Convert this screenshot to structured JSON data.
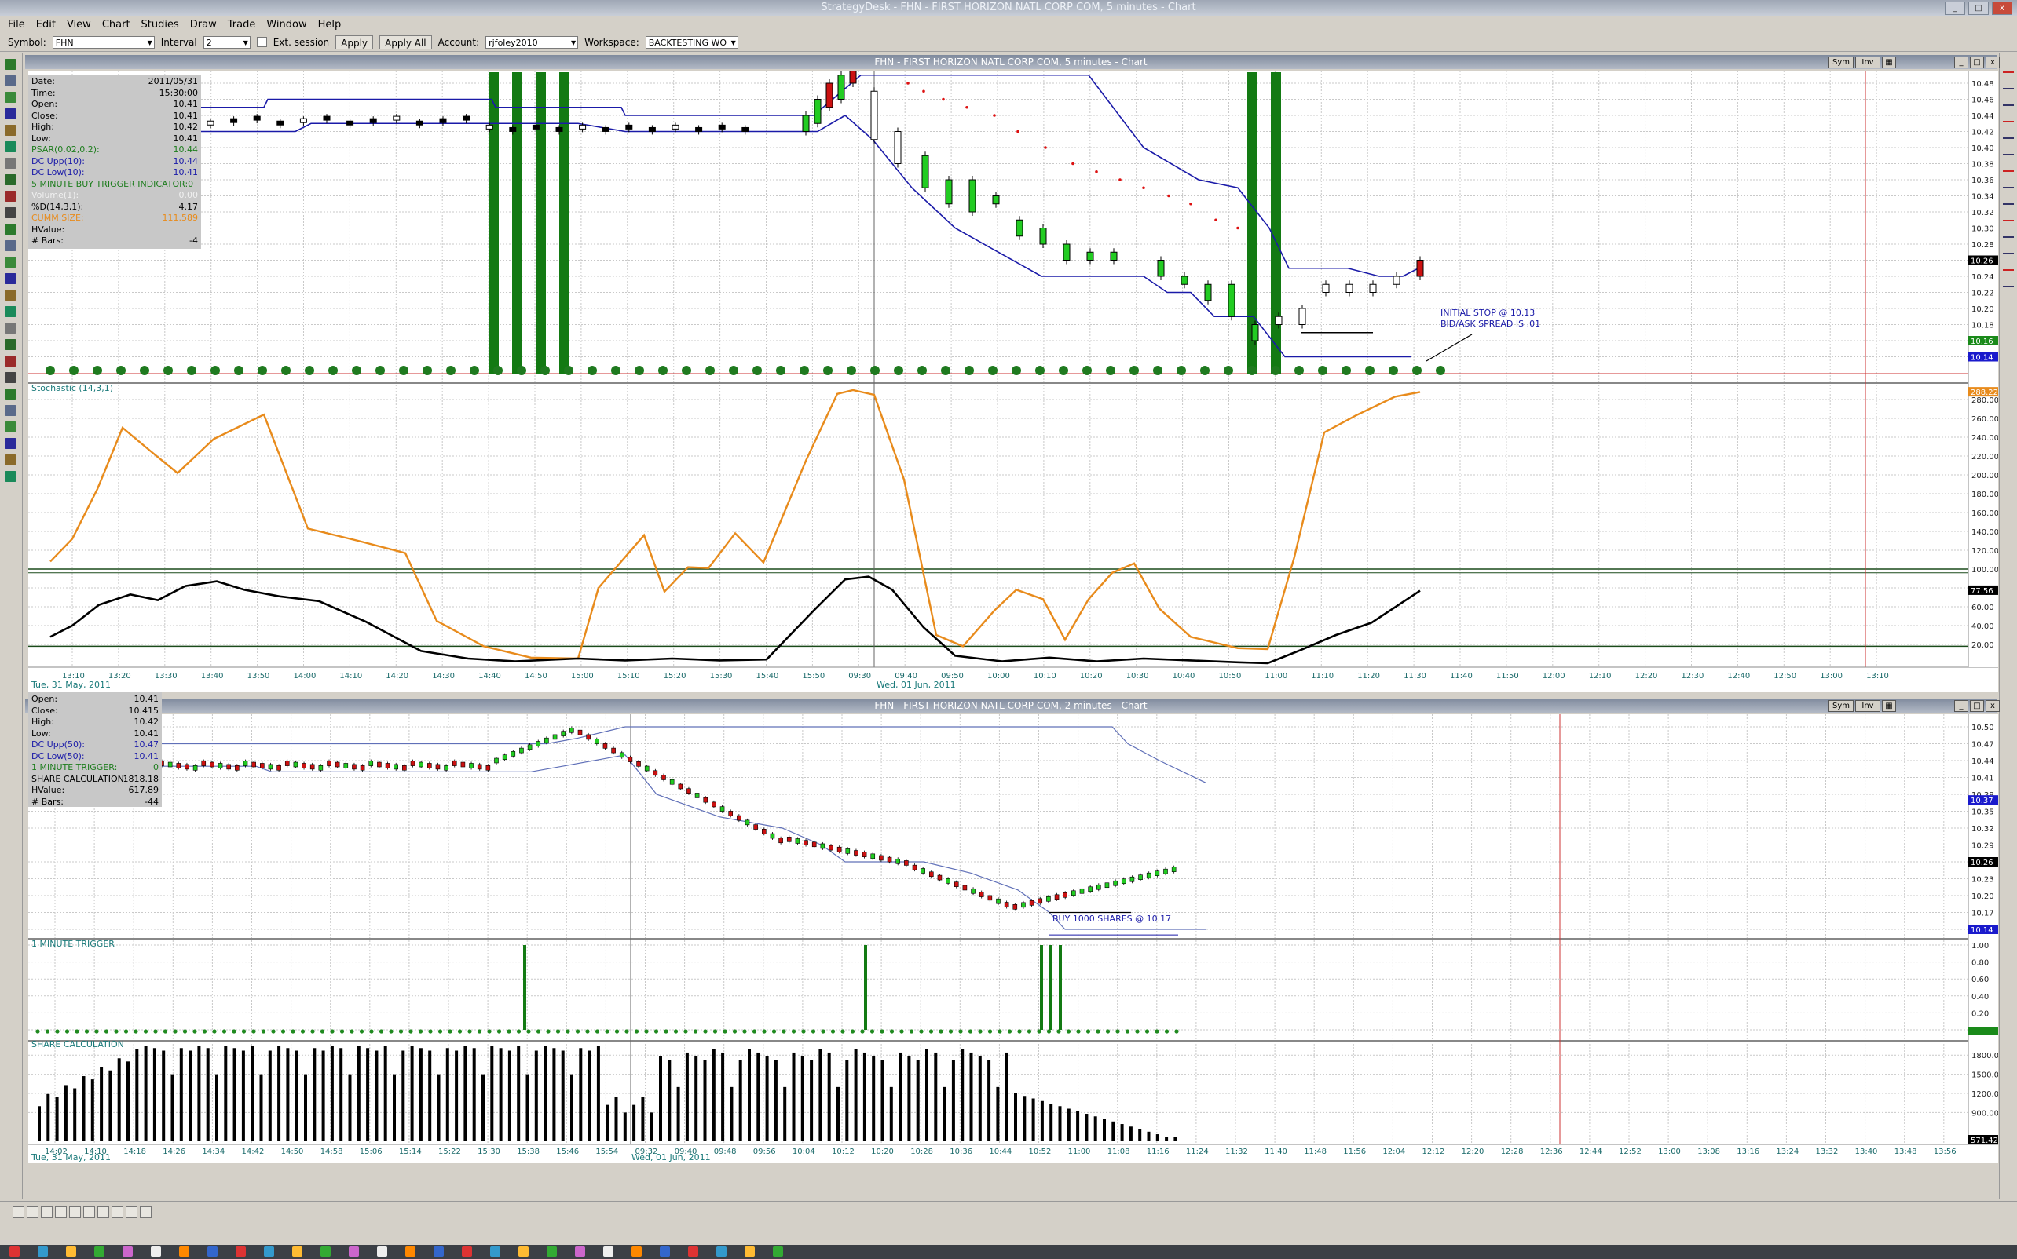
{
  "window": {
    "title": "StrategyDesk - FHN - FIRST HORIZON NATL CORP COM, 5 minutes - Chart",
    "controls": [
      "_",
      "□",
      "x"
    ]
  },
  "menu": [
    "File",
    "Edit",
    "View",
    "Chart",
    "Studies",
    "Draw",
    "Trade",
    "Window",
    "Help"
  ],
  "toolbar": {
    "symbol_label": "Symbol:",
    "symbol_value": "FHN",
    "interval_label": "Interval",
    "interval_value": "2",
    "ext_session_label": "Ext. session",
    "apply_label": "Apply",
    "apply_all_label": "Apply All",
    "account_label": "Account:",
    "account_value": "rjfoley2010",
    "workspace_label": "Workspace:",
    "workspace_value": "BACKTESTING WO"
  },
  "chart1": {
    "title": "FHN - FIRST HORIZON NATL CORP COM, 5 minutes - Chart",
    "hdr_buttons": [
      "Sym",
      "Inv"
    ],
    "info": [
      [
        "Date:",
        "2011/05/31",
        "#000"
      ],
      [
        "Time:",
        "15:30:00",
        "#000"
      ],
      [
        "Open:",
        "10.41",
        "#000"
      ],
      [
        "Close:",
        "10.41",
        "#000"
      ],
      [
        "High:",
        "10.42",
        "#000"
      ],
      [
        "Low:",
        "10.41",
        "#000"
      ],
      [
        "PSAR(0.02,0.2):",
        "10.44",
        "#1e7d1e"
      ],
      [
        "DC Upp(10):",
        "10.44",
        "#1a1aa8"
      ],
      [
        "DC Low(10):",
        "10.41",
        "#1a1aa8"
      ],
      [
        "5 MINUTE BUY TRIGGER INDICATOR:0",
        "",
        "#1e7d1e"
      ],
      [
        "Volume(1):",
        "0.00",
        "#f0f0f0"
      ],
      [
        "%D(14,3,1):",
        "4.17",
        "#000"
      ],
      [
        "CUMM.SIZE:",
        "111.589",
        "#e88b1c"
      ],
      [
        "HValue:",
        "",
        "#000"
      ],
      [
        "# Bars:",
        "-4",
        "#000"
      ]
    ],
    "price_axis": [
      "10.48",
      "10.46",
      "10.44",
      "10.42",
      "10.40",
      "10.38",
      "10.36",
      "10.34",
      "10.32",
      "10.30",
      "10.28",
      "10.26",
      "10.24",
      "10.22",
      "10.20",
      "10.18",
      "10.16",
      "10.14"
    ],
    "price_markers": [
      {
        "text": "10.26",
        "bg": "#000000"
      },
      {
        "text": "10.16",
        "bg": "#1a8a1a"
      },
      {
        "text": "10.14",
        "bg": "#1a1acc"
      }
    ],
    "annotations": [
      "INITIAL STOP @ 10.13",
      "BID/ASK SPREAD IS .01"
    ],
    "stoch_label": "Stochastic (14,3,1)",
    "stoch_axis": [
      "280.00",
      "260.00",
      "240.00",
      "220.00",
      "200.00",
      "180.00",
      "160.00",
      "140.00",
      "120.00",
      "100.00",
      "80.00",
      "60.00",
      "40.00",
      "20.00"
    ],
    "stoch_markers": [
      {
        "text": "288.225",
        "bg": "#e88b1c"
      },
      {
        "text": "77.56",
        "bg": "#000000"
      }
    ],
    "time_axis": [
      "13:10",
      "13:20",
      "13:30",
      "13:40",
      "13:50",
      "14:00",
      "14:10",
      "14:20",
      "14:30",
      "14:40",
      "14:50",
      "15:00",
      "15:10",
      "15:20",
      "15:30",
      "15:40",
      "15:50",
      "09:30",
      "09:40",
      "09:50",
      "10:00",
      "10:10",
      "10:20",
      "10:30",
      "10:40",
      "10:50",
      "11:00",
      "11:10",
      "11:20",
      "11:30",
      "11:40",
      "11:50",
      "12:00",
      "12:10",
      "12:20",
      "12:30",
      "12:40",
      "12:50",
      "13:00",
      "13:10"
    ],
    "date_left": "Tue, 31 May, 2011",
    "date_right": "Wed, 01 Jun, 2011"
  },
  "chart2": {
    "title": "FHN - FIRST HORIZON NATL CORP COM, 2 minutes - Chart",
    "hdr_buttons": [
      "Sym",
      "Inv"
    ],
    "info": [
      [
        "Open:",
        "10.41",
        "#000"
      ],
      [
        "Close:",
        "10.415",
        "#000"
      ],
      [
        "High:",
        "10.42",
        "#000"
      ],
      [
        "Low:",
        "10.41",
        "#000"
      ],
      [
        "DC Upp(50):",
        "10.47",
        "#1a1aa8"
      ],
      [
        "DC Low(50):",
        "10.41",
        "#1a1aa8"
      ],
      [
        "1 MINUTE TRIGGER:",
        "0",
        "#1e7d1e"
      ],
      [
        "SHARE CALCULATION:",
        "1818.18",
        "#000"
      ],
      [
        "HValue:",
        "617.89",
        "#000"
      ],
      [
        "# Bars:",
        "-44",
        "#000"
      ]
    ],
    "price_axis": [
      "10.50",
      "10.47",
      "10.44",
      "10.41",
      "10.38",
      "10.35",
      "10.32",
      "10.29",
      "10.26",
      "10.23",
      "10.20",
      "10.17",
      "10.14"
    ],
    "price_markers": [
      {
        "text": "10.37",
        "bg": "#1a1acc"
      },
      {
        "text": "10.26",
        "bg": "#000000"
      },
      {
        "text": "10.14",
        "bg": "#1a1acc"
      }
    ],
    "annotation": "BUY 1000 SHARES @ 10.17",
    "trigger_label": "1 MINUTE TRIGGER",
    "trigger_axis": [
      "1.00",
      "0.80",
      "0.60",
      "0.40",
      "0.20",
      "0"
    ],
    "share_label": "SHARE CALCULATION",
    "share_axis": [
      "1800.00",
      "1500.00",
      "1200.00",
      "900.00"
    ],
    "share_marker": "571.429",
    "time_axis": [
      "14:02",
      "14:10",
      "14:18",
      "14:26",
      "14:34",
      "14:42",
      "14:50",
      "14:58",
      "15:06",
      "15:14",
      "15:22",
      "15:30",
      "15:38",
      "15:46",
      "15:54",
      "09:32",
      "09:40",
      "09:48",
      "09:56",
      "10:04",
      "10:12",
      "10:20",
      "10:28",
      "10:36",
      "10:44",
      "10:52",
      "11:00",
      "11:08",
      "11:16",
      "11:24",
      "11:32",
      "11:40",
      "11:48",
      "11:56",
      "12:04",
      "12:12",
      "12:20",
      "12:28",
      "12:36",
      "12:44",
      "12:52",
      "13:00",
      "13:08",
      "13:16",
      "13:24",
      "13:32",
      "13:40",
      "13:48",
      "13:56"
    ],
    "date_left": "Tue, 31 May, 2011",
    "date_right": "Wed, 01 Jun, 2011"
  },
  "colors": {
    "grid": "#c9c9c9",
    "dc_line": "#1a1aa8",
    "stoch_orange": "#e88b1c",
    "stoch_black": "#000000",
    "trigger_green": "#137a13",
    "candle_up": "#22cc22",
    "candle_down": "#cc1111"
  }
}
